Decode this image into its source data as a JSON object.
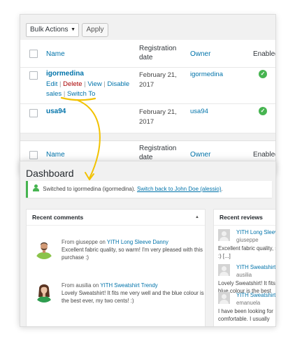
{
  "users_list": {
    "bulk_actions": {
      "selected": "Bulk Actions"
    },
    "apply_label": "Apply",
    "headers": {
      "name": "Name",
      "registration_date": "Registration date",
      "owner": "Owner",
      "enabled": "Enabled"
    },
    "rows": [
      {
        "name": "igormedina",
        "actions": {
          "edit": "Edit",
          "delete": "Delete",
          "view": "View",
          "disable_sales": "Disable sales",
          "switch_to": "Switch To"
        },
        "registration_date": "February 21, 2017",
        "owner": "igormedina",
        "enabled": true
      },
      {
        "name": "usa94",
        "registration_date": "February 21, 2017",
        "owner": "usa94",
        "enabled": true
      }
    ]
  },
  "dashboard": {
    "title": "Dashboard",
    "notice": {
      "text": "Switched to igormedina (igormedina).",
      "link": "Switch back to John Doe (alessio)"
    },
    "recent_comments": {
      "title": "Recent comments",
      "items": [
        {
          "from_prefix": "From",
          "author": "giuseppe",
          "on": "on",
          "product": "YITH Long Sleeve Danny",
          "text": "Excellent fabric quality, so warm! I'm very pleased with this purchase :)"
        },
        {
          "from_prefix": "From",
          "author": "ausilia",
          "on": "on",
          "product": "YITH Sweatshirt Trendy",
          "text": "Lovely Sweatshirt! It fits me very well and the blue colour is the best ever, my two cents! :)"
        }
      ]
    },
    "recent_reviews": {
      "title": "Recent reviews",
      "items": [
        {
          "product": "YITH Long Sleeve",
          "user": "giuseppe",
          "text": "Excellent fabric quality, so :) [...]"
        },
        {
          "product": "YITH Sweatshirt",
          "user": "ausilia",
          "text": "Lovely Sweatshirt! It fits blue colour is the best"
        },
        {
          "product": "YITH Sweatshirt",
          "user": "emanuela",
          "text": "I have been looking for comfortable. I usually"
        }
      ]
    }
  },
  "colors": {
    "link": "#0073aa",
    "success": "#46b450",
    "delete": "#aa0000",
    "highlight": "#f2c200"
  }
}
